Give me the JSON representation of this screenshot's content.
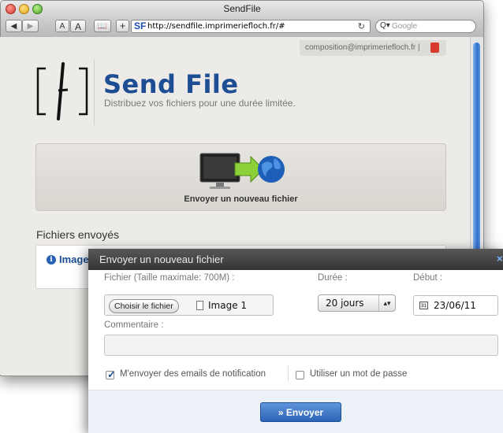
{
  "window": {
    "title": "SendFile",
    "url": "http://sendfile.imprimeriefloch.fr/#",
    "search_placeholder": "Google",
    "favicon_text": "SF",
    "toolbar": {
      "font_small": "A",
      "font_large": "A",
      "add": "+"
    }
  },
  "header": {
    "user_email": "composition@imprimeriefloch.fr |",
    "brand": "Send File",
    "tagline": "Distribuez vos fichiers pour une durée limitée."
  },
  "upload": {
    "label": "Envoyer un nouveau fichier"
  },
  "files": {
    "section_title": "Fichiers envoyés",
    "items": [
      {
        "name": "Image"
      }
    ]
  },
  "dialog": {
    "title": "Envoyer un nouveau fichier",
    "close": "×",
    "file_label": "Fichier (Taille maximale: 700M) :",
    "choose_button": "Choisir le fichier",
    "chosen_file": "Image 1",
    "duree_label": "Durée :",
    "duree_value": "20 jours",
    "debut_label": "Début :",
    "calendar_day": "31",
    "debut_value": "23/06/11",
    "comment_label": "Commentaire :",
    "comment_value": "",
    "notify_label": "M'envoyer des emails de notification",
    "notify_checked": true,
    "password_label": "Utiliser un mot de passe",
    "password_checked": false,
    "send_button": "» Envoyer"
  },
  "colors": {
    "brand": "#1d4e94",
    "accent": "#2d63b5",
    "header_dark": "#353535"
  }
}
